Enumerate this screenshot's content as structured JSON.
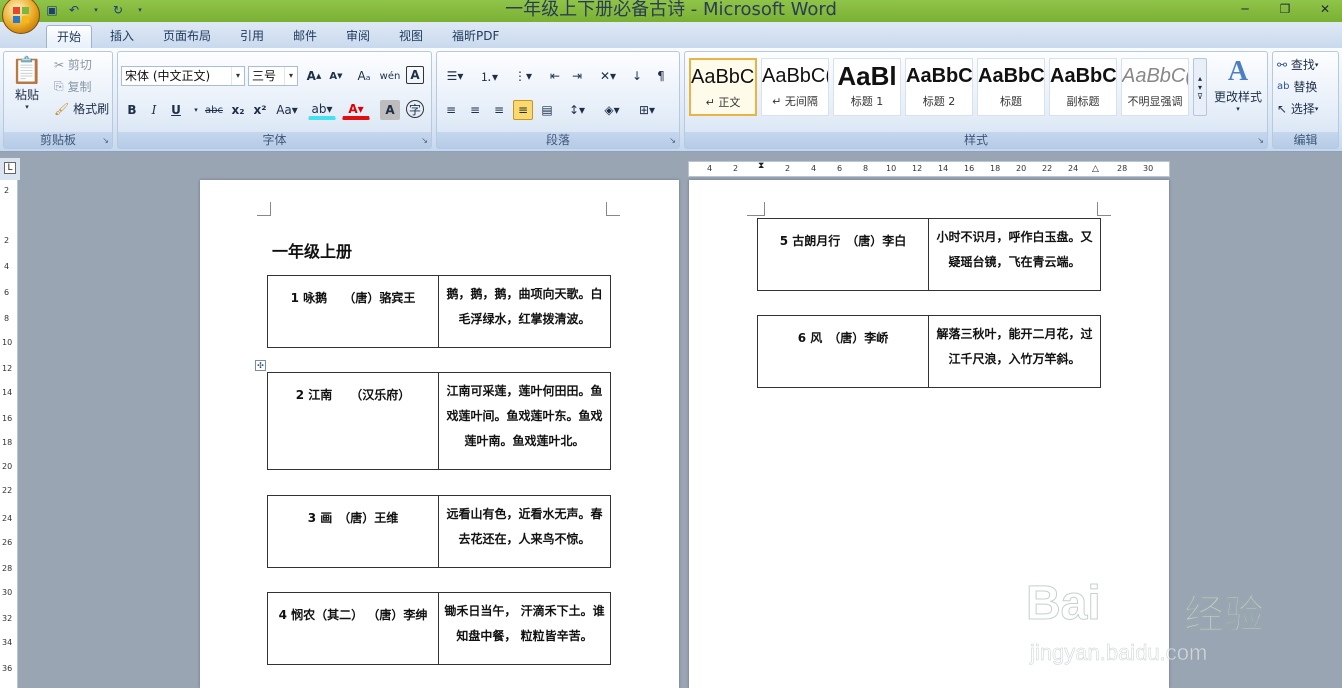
{
  "window": {
    "title": "一年级上下册必备古诗 - Microsoft Word"
  },
  "tabs": [
    "开始",
    "插入",
    "页面布局",
    "引用",
    "邮件",
    "审阅",
    "视图",
    "福昕PDF"
  ],
  "clipboard": {
    "paste": "粘贴",
    "cut": "剪切",
    "copy": "复制",
    "format_painter": "格式刷",
    "label": "剪贴板"
  },
  "font": {
    "name": "宋体 (中文正文)",
    "size": "三号",
    "label": "字体"
  },
  "paragraph": {
    "label": "段落"
  },
  "styles": {
    "items": [
      {
        "sample": "AaBbC(",
        "name": "↵ 正文"
      },
      {
        "sample": "AaBbC(",
        "name": "↵ 无间隔"
      },
      {
        "sample": "AaBl",
        "name": "标题 1"
      },
      {
        "sample": "AaBbC(",
        "name": "标题 2"
      },
      {
        "sample": "AaBbC(",
        "name": "标题"
      },
      {
        "sample": "AaBbC(",
        "name": "副标题"
      },
      {
        "sample": "AaBbC(",
        "name": "不明显强调"
      }
    ],
    "change": "更改样式",
    "label": "样式"
  },
  "editing": {
    "find": "查找",
    "replace": "替换",
    "select": "选择",
    "label": "编辑"
  },
  "hruler_ticks": [
    "4",
    "2",
    "2",
    "4",
    "6",
    "8",
    "10",
    "12",
    "14",
    "16",
    "18",
    "20",
    "22",
    "24",
    "28",
    "30"
  ],
  "vruler_ticks": [
    "2",
    "2",
    "4",
    "6",
    "8",
    "10",
    "12",
    "14",
    "16",
    "18",
    "20",
    "22",
    "24",
    "26",
    "28",
    "30",
    "32",
    "34",
    "36"
  ],
  "document": {
    "heading": "一年级上册",
    "left_poems": [
      {
        "title": "1 咏鹅　 （唐）骆宾王",
        "verse": "鹅，鹅，鹅，曲项向天歌。白毛浮绿水，红掌拨清波。"
      },
      {
        "title": "2 江南　　（汉乐府）",
        "verse": "江南可采莲，莲叶何田田。鱼戏莲叶间。鱼戏莲叶东。鱼戏莲叶南。鱼戏莲叶北。"
      },
      {
        "title": "3 画　（唐）王维",
        "verse": "远看山有色，近看水无声。春去花还在，人来鸟不惊。"
      },
      {
        "title": "4 悯农（其二） （唐）李绅",
        "verse": "锄禾日当午， 汗滴禾下土。谁知盘中餐， 粒粒皆辛苦。"
      }
    ],
    "right_poems": [
      {
        "title": "5 古朗月行　（唐）李白",
        "verse": "小时不识月，呼作白玉盘。又疑瑶台镜，飞在青云端。"
      },
      {
        "title": "6 风　（唐）李峤",
        "verse": "解落三秋叶，能开二月花，过江千尺浪，入竹万竿斜。"
      }
    ]
  },
  "watermark": {
    "brand": "Bai",
    "brand2": "经验",
    "url": "jingyan.baidu.com"
  },
  "colors": {
    "titlebar": "#8fc44a",
    "ribbon": "#dbe7f5",
    "highlight": "#fbd96b"
  }
}
